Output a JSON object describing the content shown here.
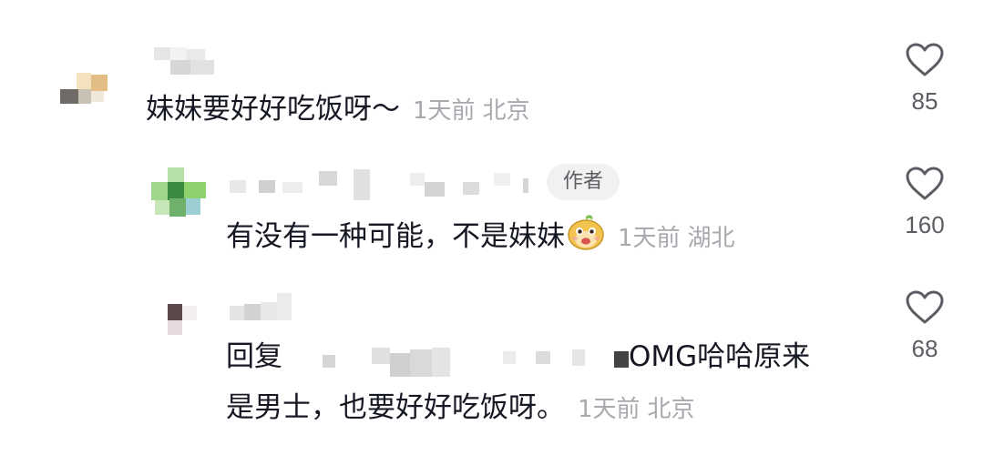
{
  "comments": [
    {
      "text": "妹妹要好好吃饭呀～",
      "time": "1天前",
      "location": "北京",
      "likes": "85"
    },
    {
      "text": "有没有一种可能，不是妹妹",
      "author_badge": "作者",
      "time": "1天前",
      "location": "湖北",
      "likes": "160"
    },
    {
      "reply_prefix": "回复",
      "text_line1": "OMG哈哈原来",
      "text_line2": "是男士，也要好好吃饭呀。",
      "time": "1天前",
      "location": "北京",
      "likes": "68"
    }
  ],
  "icons": {
    "like": "heart-outline-icon",
    "emoji": "monkey-face-emoji"
  },
  "colors": {
    "text": "#161823",
    "meta": "#a8a9ae",
    "count": "#5c5d63",
    "badge_bg": "#f1f1f2"
  }
}
